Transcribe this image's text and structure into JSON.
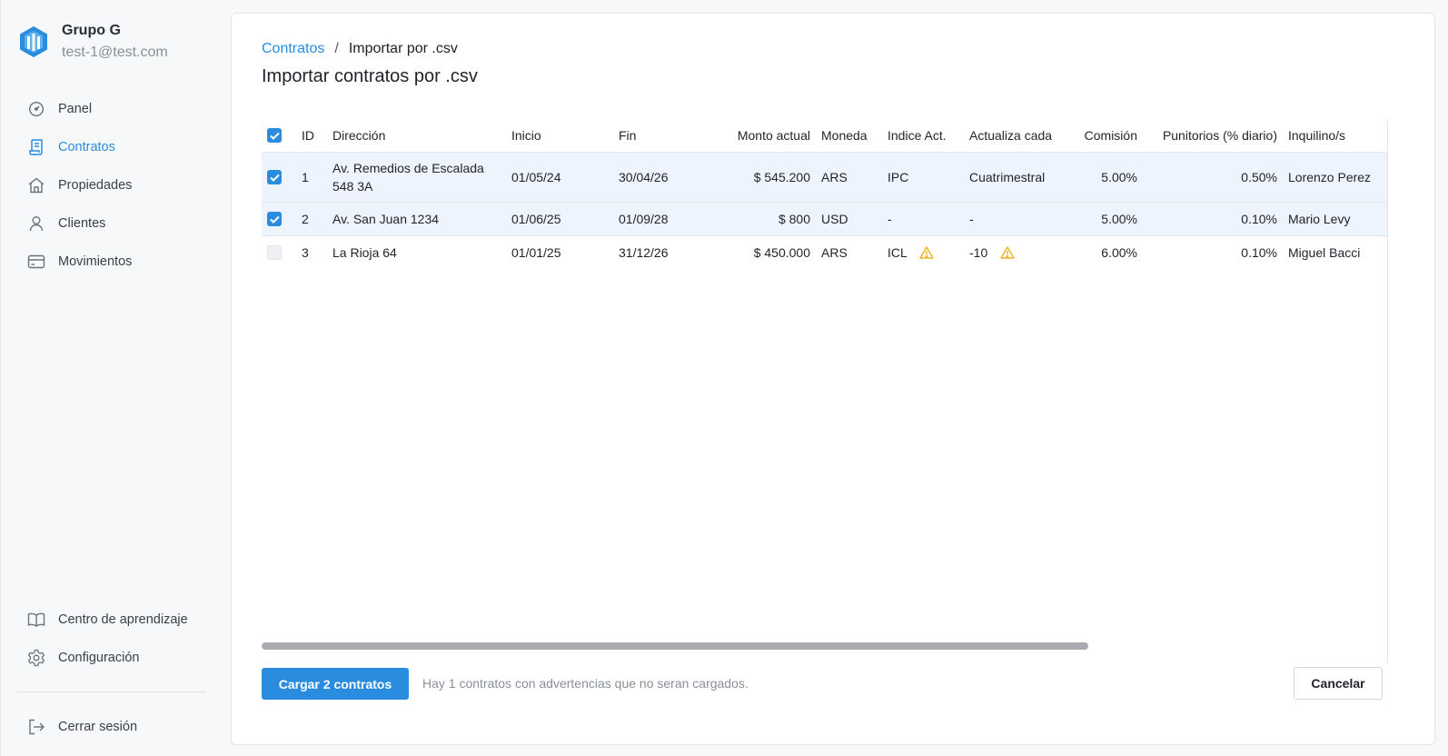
{
  "org": {
    "name": "Grupo G",
    "email": "test-1@test.com"
  },
  "nav": [
    {
      "label": "Panel",
      "icon": "gauge-icon"
    },
    {
      "label": "Contratos",
      "icon": "scroll-icon",
      "active": true
    },
    {
      "label": "Propiedades",
      "icon": "home-icon"
    },
    {
      "label": "Clientes",
      "icon": "user-icon"
    },
    {
      "label": "Movimientos",
      "icon": "card-icon"
    }
  ],
  "nav_bottom": [
    {
      "label": "Centro de aprendizaje",
      "icon": "book-icon"
    },
    {
      "label": "Configuración",
      "icon": "gear-icon"
    }
  ],
  "logout": {
    "label": "Cerrar sesión",
    "icon": "logout-icon"
  },
  "breadcrumb": {
    "parent": "Contratos",
    "separator": "/",
    "current": "Importar por .csv"
  },
  "page_title": "Importar contratos por .csv",
  "table": {
    "columns": [
      "ID",
      "Dirección",
      "Inicio",
      "Fin",
      "Monto actual",
      "Moneda",
      "Indice Act.",
      "Actualiza cada",
      "Comisión",
      "Punitorios (% diario)",
      "Inquilino/s"
    ],
    "rows": [
      {
        "checked": true,
        "id": "1",
        "direccion": "Av. Remedios de Escalada 548 3A",
        "inicio": "01/05/24",
        "fin": "30/04/26",
        "monto": "$ 545.200",
        "moneda": "ARS",
        "indice": "IPC",
        "actualiza": "Cuatrimestral",
        "comision": "5.00%",
        "punitorios": "0.50%",
        "inquilino": "Lorenzo Perez"
      },
      {
        "checked": true,
        "id": "2",
        "direccion": "Av. San Juan 1234",
        "inicio": "01/06/25",
        "fin": "01/09/28",
        "monto": "$ 800",
        "moneda": "USD",
        "indice": "-",
        "actualiza": "-",
        "comision": "5.00%",
        "punitorios": "0.10%",
        "inquilino": "Mario Levy"
      },
      {
        "checked": false,
        "id": "3",
        "direccion": "La Rioja 64",
        "inicio": "01/01/25",
        "fin": "31/12/26",
        "monto": "$ 450.000",
        "moneda": "ARS",
        "indice": "ICL",
        "actualiza": "-10",
        "comision": "6.00%",
        "punitorios": "0.10%",
        "inquilino": "Miguel Bacci",
        "warnings": [
          "indice",
          "actualiza"
        ]
      }
    ]
  },
  "actions": {
    "submit_label": "Cargar 2 contratos",
    "warning_message": "Hay 1 contratos con advertencias que no seran cargados.",
    "cancel_label": "Cancelar"
  },
  "colors": {
    "accent": "#2a8cdf",
    "selected_row": "#edf4fd",
    "warning": "#f2b01e"
  }
}
